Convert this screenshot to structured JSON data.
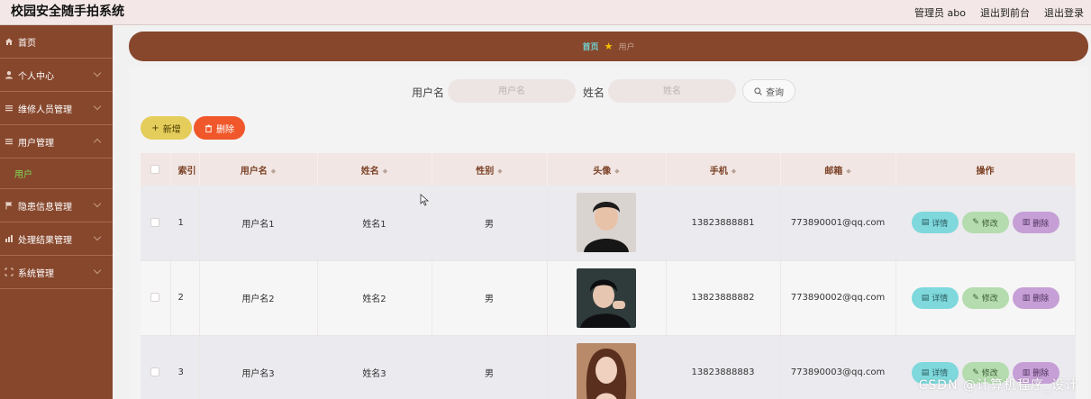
{
  "header": {
    "app_title": "校园安全随手拍系统",
    "admin_label": "管理员 abo",
    "back_to_front": "退出到前台",
    "logout": "退出登录"
  },
  "sidebar": {
    "items": [
      {
        "label": "首页",
        "icon": "home-icon"
      },
      {
        "label": "个人中心",
        "icon": "user-icon"
      },
      {
        "label": "维修人员管理",
        "icon": "list-icon"
      },
      {
        "label": "用户管理",
        "icon": "list-icon"
      },
      {
        "label": "用户",
        "icon": ""
      },
      {
        "label": "隐患信息管理",
        "icon": "flag-icon"
      },
      {
        "label": "处理结果管理",
        "icon": "chart-icon"
      },
      {
        "label": "系统管理",
        "icon": "grid-icon"
      }
    ]
  },
  "breadcrumb": {
    "home": "首页",
    "current": "用户"
  },
  "search": {
    "username_label": "用户名",
    "username_placeholder": "用户名",
    "name_label": "姓名",
    "name_placeholder": "姓名",
    "query_label": "查询"
  },
  "actions": {
    "add_label": "新增",
    "delete_label": "删除"
  },
  "table": {
    "headers": {
      "index": "索引",
      "username": "用户名",
      "name": "姓名",
      "gender": "性别",
      "avatar": "头像",
      "phone": "手机",
      "email": "邮箱",
      "ops": "操作"
    },
    "rows": [
      {
        "index": "1",
        "username": "用户名1",
        "name": "姓名1",
        "gender": "男",
        "phone": "13823888881",
        "email": "773890001@qq.com"
      },
      {
        "index": "2",
        "username": "用户名2",
        "name": "姓名2",
        "gender": "男",
        "phone": "13823888882",
        "email": "773890002@qq.com"
      },
      {
        "index": "3",
        "username": "用户名3",
        "name": "姓名3",
        "gender": "男",
        "phone": "13823888883",
        "email": "773890003@qq.com"
      }
    ],
    "op_labels": {
      "detail": "详情",
      "edit": "修改",
      "delete": "删除"
    }
  },
  "watermark": "CSDN @计算机程序_设计",
  "colors": {
    "sidebar_bg": "#87472c",
    "breadcrumb_home": "#6fd3d0",
    "add_button": "#e4cd5a",
    "delete_button": "#f0572a",
    "detail_button": "#7ed8dc",
    "edit_button": "#b4dcae",
    "row_delete_button": "#c69fd6"
  }
}
